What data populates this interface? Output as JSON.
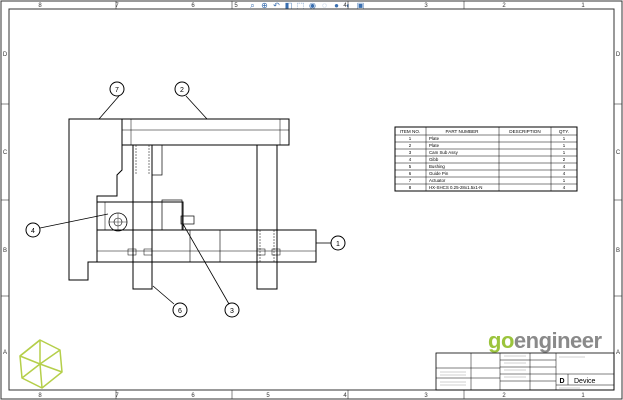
{
  "zone_labels": {
    "top": [
      "8",
      "7",
      "6",
      "5",
      "4",
      "3",
      "2",
      "1"
    ],
    "bottom": [
      "8",
      "7",
      "6",
      "5",
      "4",
      "3",
      "2",
      "1"
    ],
    "left": [
      "D",
      "C",
      "B",
      "A"
    ],
    "right": [
      "D",
      "C",
      "B",
      "A"
    ]
  },
  "view_toolbar": {
    "icons": [
      "zoom-to-fit-icon",
      "zoom-area-icon",
      "previous-view-icon",
      "section-view-icon",
      "view-orientation-icon",
      "display-style-icon",
      "hide-show-icon",
      "edit-appearance-icon",
      "apply-scene-icon",
      "view-settings-icon"
    ]
  },
  "balloons": [
    "7",
    "2",
    "4",
    "1",
    "6",
    "3"
  ],
  "bom": {
    "headers": [
      "ITEM NO.",
      "PART NUMBER",
      "DESCRIPTION",
      "QTY."
    ],
    "rows": [
      [
        "1",
        "Plate",
        "",
        "1"
      ],
      [
        "2",
        "Plate",
        "",
        "1"
      ],
      [
        "3",
        "Cam Sub Assy",
        "",
        "1"
      ],
      [
        "4",
        "Gibb",
        "",
        "2"
      ],
      [
        "5",
        "Bushing",
        "",
        "4"
      ],
      [
        "6",
        "Guide Pin",
        "",
        "4"
      ],
      [
        "7",
        "Actuator",
        "",
        "1"
      ],
      [
        "8",
        "HX-SHCS 0.25-28x1.5x1-N",
        "",
        "4"
      ]
    ]
  },
  "logo": {
    "part1": "go",
    "part2": "engineer",
    "color_go": "#9bc43c",
    "color_engineer": "#8a8a8a"
  },
  "title_block": {
    "size": "D",
    "title": "Device"
  },
  "colors": {
    "line": "#000000",
    "border": "#333333",
    "logo_icon": "#b5cf4a"
  }
}
